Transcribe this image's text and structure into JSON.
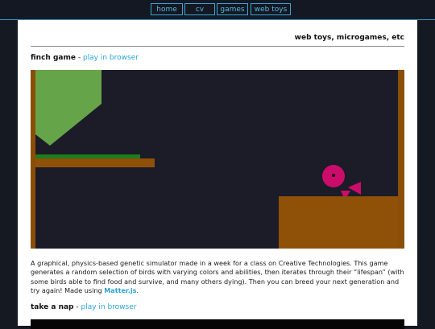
{
  "nav": {
    "items": [
      {
        "label": "home"
      },
      {
        "label": "cv"
      },
      {
        "label": "games"
      },
      {
        "label": "web toys"
      }
    ]
  },
  "page": {
    "section_title": "web toys, microgames, etc"
  },
  "entries": [
    {
      "title": "finch game",
      "separator": " - ",
      "link_label": "play in browser",
      "description_before_link": "A graphical, physics-based genetic simulator made in a week for a class on Creative Technologies. This game generates a random selection of birds with varying colors and abilities, then iterates through their “lifespan” (with some birds able to find food and survive, and many others dying). Then you can breed your next generation and try again! Made using ",
      "description_link": "Matter.js",
      "description_after_link": "."
    },
    {
      "title": "take a nap",
      "separator": " - ",
      "link_label": "play in browser"
    }
  ],
  "colors": {
    "accent": "#2aa2d6",
    "page_background": "#151922",
    "game_background": "#1b1c27",
    "wall": "#8a4e07",
    "ledge": "#8f5008",
    "grass": "#1e7d1c",
    "bush": "#66a449",
    "bird": "#cc0c6a"
  }
}
